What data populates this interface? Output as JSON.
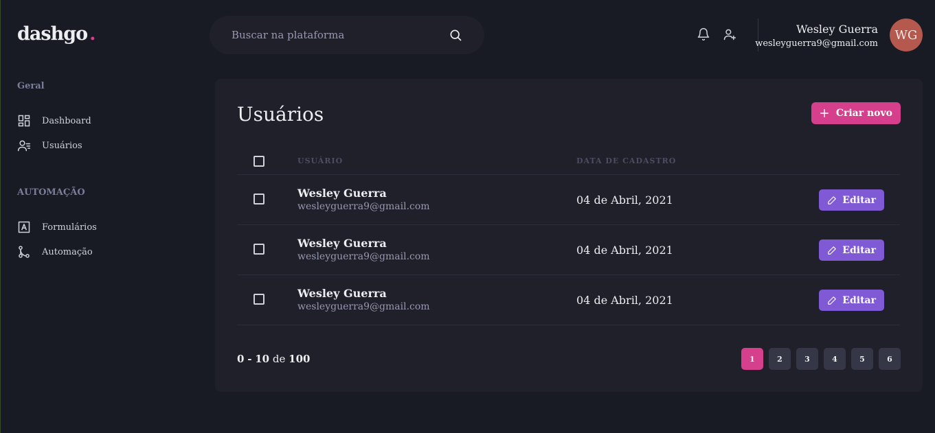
{
  "app": {
    "logo": "dashgo",
    "logo_dot": "."
  },
  "search": {
    "placeholder": "Buscar na plataforma"
  },
  "profile": {
    "name": "Wesley Guerra",
    "email": "wesleyguerra9@gmail.com",
    "initials": "WG"
  },
  "sidebar": {
    "sections": [
      {
        "title": "Geral",
        "items": [
          {
            "label": "Dashboard",
            "icon": "dashboard-icon"
          },
          {
            "label": "Usuários",
            "icon": "users-icon"
          }
        ]
      },
      {
        "title": "AUTOMAÇÃO",
        "items": [
          {
            "label": "Formulários",
            "icon": "form-icon"
          },
          {
            "label": "Automação",
            "icon": "git-merge-icon"
          }
        ]
      }
    ]
  },
  "main": {
    "title": "Usuários",
    "create_label": "Criar novo",
    "columns": [
      "USUÁRIO",
      "DATA DE CADASTRO"
    ],
    "rows": [
      {
        "name": "Wesley Guerra",
        "email": "wesleyguerra9@gmail.com",
        "date": "04 de Abril, 2021",
        "edit_label": "Editar"
      },
      {
        "name": "Wesley Guerra",
        "email": "wesleyguerra9@gmail.com",
        "date": "04 de Abril, 2021",
        "edit_label": "Editar"
      },
      {
        "name": "Wesley Guerra",
        "email": "wesleyguerra9@gmail.com",
        "date": "04 de Abril, 2021",
        "edit_label": "Editar"
      }
    ],
    "pagination": {
      "from": "0",
      "to": "10",
      "of_word": "de",
      "total": "100",
      "pages": [
        "1",
        "2",
        "3",
        "4",
        "5",
        "6"
      ],
      "current": "1"
    }
  },
  "colors": {
    "background": "#181b23",
    "panel": "#1f2029",
    "accent_pink": "#d53f8c",
    "accent_purple": "#805ad5",
    "avatar": "#b5584e"
  }
}
